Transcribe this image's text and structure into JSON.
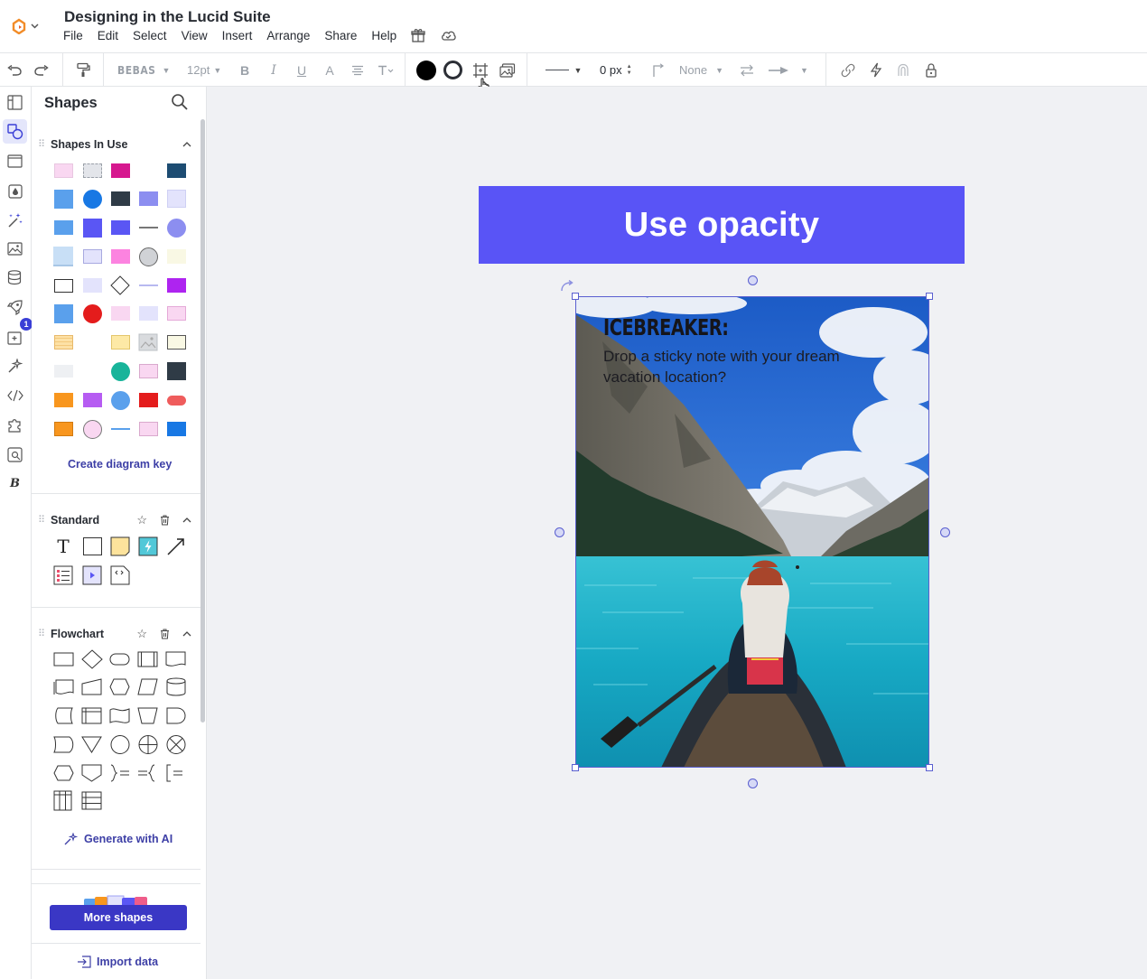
{
  "document": {
    "title": "Designing in the Lucid Suite"
  },
  "menu": [
    "File",
    "Edit",
    "Select",
    "View",
    "Insert",
    "Arrange",
    "Share",
    "Help"
  ],
  "toolbar": {
    "font": "BEBAS",
    "font_size": "12pt",
    "line_width": "0 px",
    "endpoint": "None",
    "fill_color": "#000000",
    "line_color": "#282c33"
  },
  "rail": {
    "badge_count": "1"
  },
  "panel": {
    "title": "Shapes",
    "sections": {
      "in_use": "Shapes In Use",
      "standard": "Standard",
      "flowchart": "Flowchart"
    },
    "create_key": "Create diagram key",
    "generate_ai": "Generate with AI",
    "more_shapes": "More shapes",
    "import_data": "Import data"
  },
  "shapes_in_use": [
    [
      "swatch-pink-light",
      "swatch-gray-dashed",
      "swatch-magenta",
      "",
      "swatch-navy"
    ],
    [
      "swatch-blue",
      "circle-blue",
      "swatch-charcoal",
      "swatch-periwinkle",
      "swatch-lavender"
    ],
    [
      "swatch-blue-2",
      "swatch-indigo",
      "swatch-indigo-2",
      "line-gray",
      "circle-periwinkle"
    ],
    [
      "note-blue-light",
      "swatch-lavender-2",
      "swatch-pink",
      "circle-gray",
      "swatch-cream"
    ],
    [
      "rect-outline",
      "swatch-lavender-3",
      "diamond-outline",
      "line-lavender",
      "swatch-purple"
    ],
    [
      "swatch-blue-3",
      "circle-red",
      "swatch-pink-2",
      "swatch-lavender-4",
      "swatch-pink-3"
    ],
    [
      "note-yellow-lined",
      "",
      "swatch-yellow",
      "image-placeholder",
      "swatch-beige"
    ],
    [
      "swatch-white",
      "",
      "circle-teal",
      "swatch-pink-4",
      "swatch-charcoal-2"
    ],
    [
      "swatch-orange",
      "swatch-violet",
      "circle-blue-2",
      "swatch-red",
      "pill-red"
    ],
    [
      "swatch-orange-2",
      "circle-pink",
      "line-blue",
      "swatch-pink-5",
      "swatch-blue-4"
    ]
  ],
  "canvas": {
    "banner_text": "Use opacity",
    "card_title": "ICEBREAKER:",
    "card_text": "Drop a sticky note with your dream vacation location?"
  },
  "colors": {
    "accent": "#5954f6",
    "primary_button": "#3a37c5",
    "selection": "#5a5fd0",
    "canvas_bg": "#f0f1f4"
  }
}
